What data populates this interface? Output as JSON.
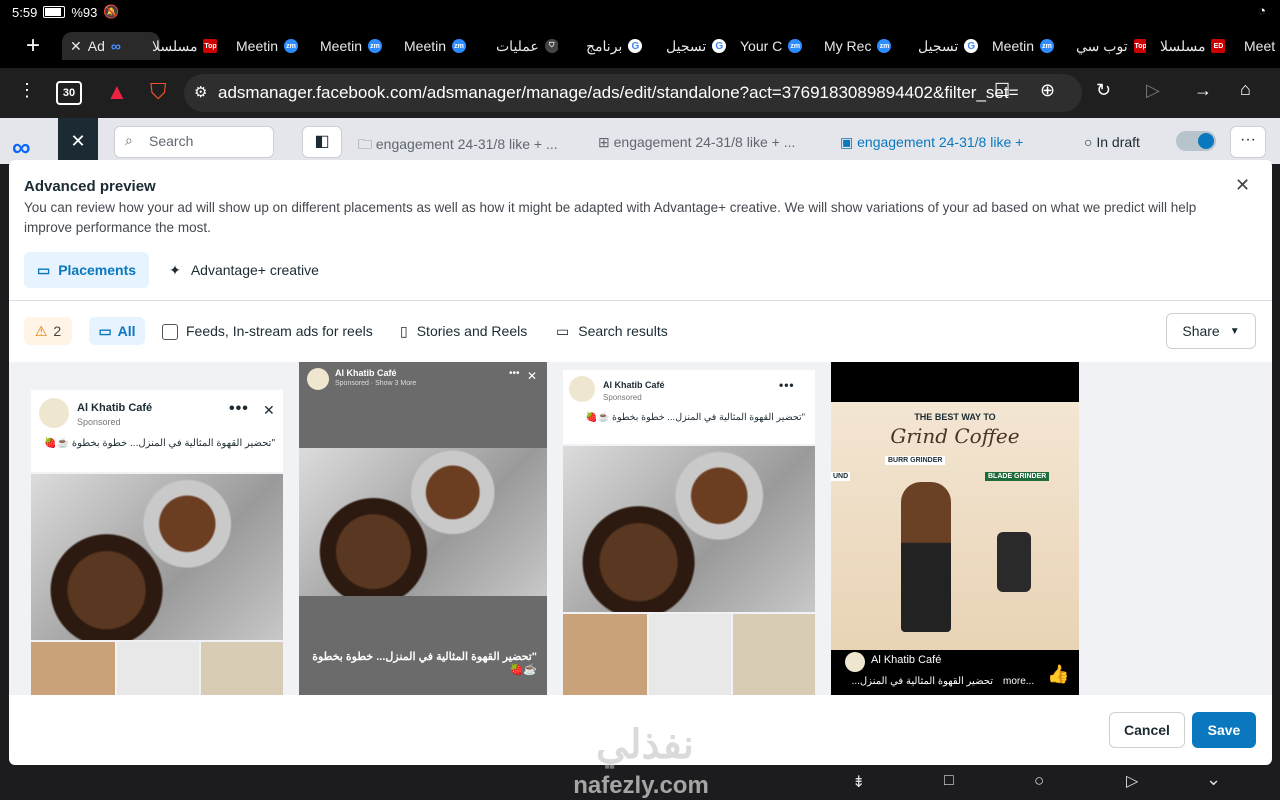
{
  "status": {
    "time": "5:59",
    "battery": "%93"
  },
  "tabs": [
    {
      "label": "Ad",
      "icon": "meta-icon"
    },
    {
      "label": "مسلسلا",
      "icon": "top-icon"
    },
    {
      "label": "Meetin",
      "icon": "zoom-icon"
    },
    {
      "label": "Meetin",
      "icon": "zoom-icon"
    },
    {
      "label": "Meetin",
      "icon": "zoom-icon"
    },
    {
      "label": "عمليات",
      "icon": "brave-icon"
    },
    {
      "label": "برنامج",
      "icon": "google-icon"
    },
    {
      "label": "تسجيل",
      "icon": "google-icon"
    },
    {
      "label": "Your C",
      "icon": "zoom-icon"
    },
    {
      "label": "My Rec",
      "icon": "zoom-icon"
    },
    {
      "label": "تسجيل",
      "icon": "google-icon"
    },
    {
      "label": "Meetin",
      "icon": "zoom-icon"
    },
    {
      "label": "توب سي",
      "icon": "top-icon"
    },
    {
      "label": "مسلسلا",
      "icon": "ed-icon"
    },
    {
      "label": "Meet",
      "icon": ""
    }
  ],
  "browser": {
    "url": "adsmanager.facebook.com/adsmanager/manage/ads/edit/standalone?act=3769183089894402&filter_set=",
    "tab_count": "30"
  },
  "fb": {
    "search_placeholder": "Search",
    "crumb1": "engagement 24-31/8 like + ...",
    "crumb2": "engagement 24-31/8 like + ...",
    "crumb3": "engagement 24-31/8 like +",
    "status": "In draft"
  },
  "modal": {
    "title": "Advanced preview",
    "desc": "You can review how your ad will show up on different placements as well as how it might be adapted with Advantage+ creative. We will show variations of your ad based on what we predict will help improve performance the most.",
    "tab_placements": "Placements",
    "tab_advantage": "Advantage+ creative",
    "warning_count": "2",
    "filter_all": "All",
    "filter_feeds": "Feeds, In-stream ads for reels",
    "filter_stories": "Stories and Reels",
    "filter_search": "Search results",
    "share": "Share",
    "cancel": "Cancel",
    "save": "Save"
  },
  "ad": {
    "page_name": "Al Khatib Café",
    "sponsored": "Sponsored",
    "sponsored_more": "Sponsored · Show 3 More",
    "caption": "\"تحضير القهوة المثالية في المنزل... خطوة بخطوة ☕🍓",
    "caption_short": "تحضير القهوة المثالية في المنزل...",
    "more": "more...",
    "poster_line1": "THE BEST WAY TO",
    "poster_line2": "Grind Coffee",
    "burr": "BURR GRINDER",
    "blade": "BLADE GRINDER",
    "und": "UND"
  },
  "watermark": {
    "ar": "نفذلي",
    "en": "nafezly.com"
  },
  "colors": {
    "accent": "#0a78be",
    "save": "#1877f2",
    "chip_bg": "#e7f3ff"
  }
}
